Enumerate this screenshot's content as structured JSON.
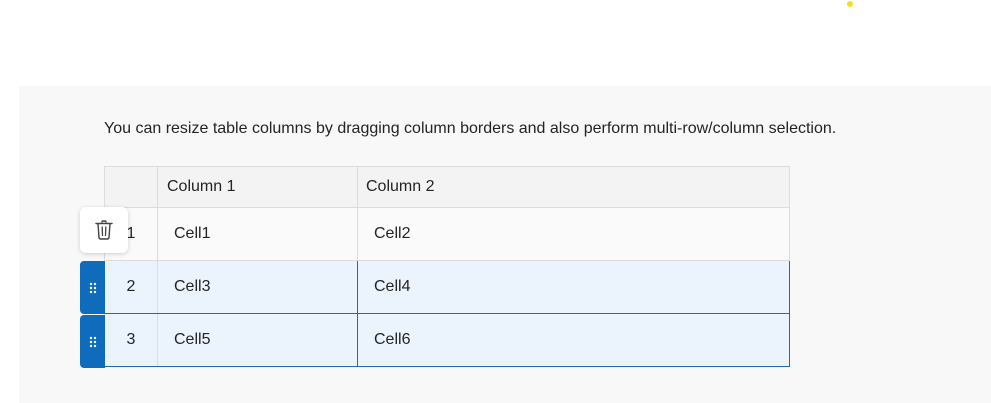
{
  "description": "You can resize table columns by dragging column borders and also perform multi-row/column selection.",
  "table": {
    "headers": [
      "",
      "Column 1",
      "Column 2"
    ],
    "rows": [
      {
        "num": "1",
        "cells": [
          "Cell1",
          "Cell2"
        ],
        "selected": false
      },
      {
        "num": "2",
        "cells": [
          "Cell3",
          "Cell4"
        ],
        "selected": true
      },
      {
        "num": "3",
        "cells": [
          "Cell5",
          "Cell6"
        ],
        "selected": true
      }
    ]
  },
  "icons": {
    "delete": "trash-icon",
    "drag_handle": "drag-grip-icon"
  },
  "colors": {
    "accent": "#0f6cbd",
    "selection_bg": "#ebf3fc",
    "selection_border": "#1a6fa8",
    "indicator_dot": "#f5e11a"
  }
}
